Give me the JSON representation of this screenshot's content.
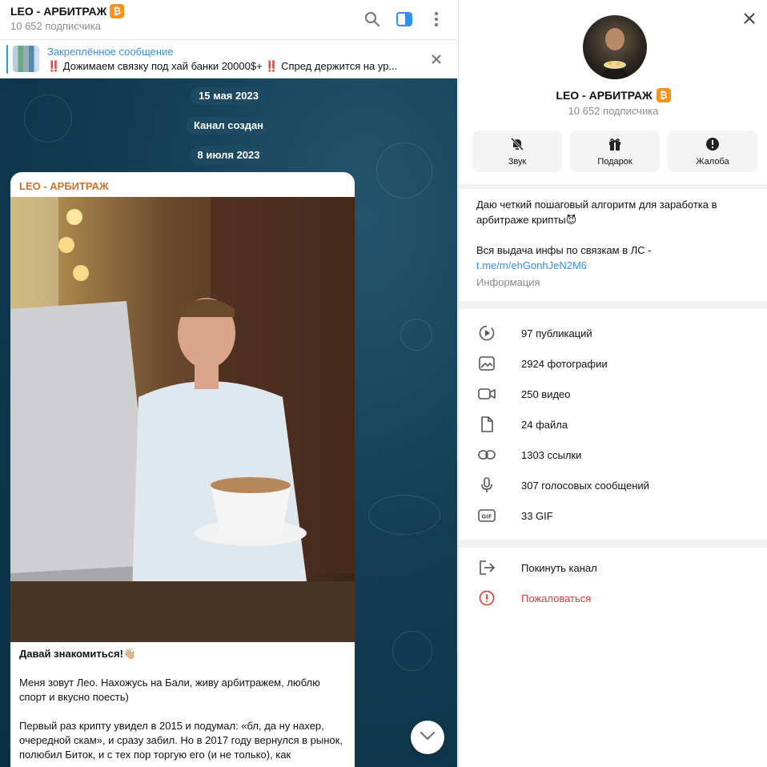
{
  "channel": {
    "title": "LEO - АРБИТРАЖ",
    "subscribers": "10 652 подписчика"
  },
  "pinned": {
    "label": "Закреплённое сообщение",
    "text": "‼️ Дожимаем связку под хай банки 20000$+ ‼️ Спред держится на ур..."
  },
  "dates": {
    "first": "15 мая 2023",
    "created": "Канал создан",
    "second": "8 июля 2023"
  },
  "message": {
    "author": "LEO - АРБИТРАЖ",
    "heading": "Давай знакомиться!👋🏼",
    "p1": "Меня зовут Лео. Нахожусь на Бали, живу арбитражем, люблю спорт и вкусно поесть)",
    "p2": "Первый раз крипту увидел в 2015 и подумал: «бл, да ну нахер, очередной скам», и сразу забил. Но в 2017 году вернулся в рынок, полюбил Биток, и с тех пор торгую его (и не только), как"
  },
  "profile": {
    "title": "LEO - АРБИТРАЖ",
    "subscribers": "10 652 подписчика",
    "actions": [
      {
        "label": "Звук",
        "icon": "bell-off-icon"
      },
      {
        "label": "Подарок",
        "icon": "gift-icon"
      },
      {
        "label": "Жалоба",
        "icon": "alert-icon"
      }
    ],
    "about_1": "Даю четкий пошаговый алгоритм для заработка в арбитраже крипты😈",
    "about_2": "Вся выдача инфы по связкам в ЛС -",
    "about_link": "t.me/m/ehGonhJeN2M6",
    "about_caption": "Информация",
    "stats": [
      {
        "label": "97 публикаций",
        "icon": "posts-icon"
      },
      {
        "label": "2924 фотографии",
        "icon": "photo-icon"
      },
      {
        "label": "250 видео",
        "icon": "video-icon"
      },
      {
        "label": "24 файла",
        "icon": "file-icon"
      },
      {
        "label": "1303 ссылки",
        "icon": "link-icon"
      },
      {
        "label": "307 голосовых сообщений",
        "icon": "mic-icon"
      },
      {
        "label": "33 GIF",
        "icon": "gif-icon"
      }
    ],
    "leave": "Покинуть канал",
    "report": "Пожаловаться"
  },
  "colors": {
    "accent": "#3390ec",
    "author": "#d0702c",
    "bitcoin": "#f7931a",
    "danger": "#e53935"
  }
}
